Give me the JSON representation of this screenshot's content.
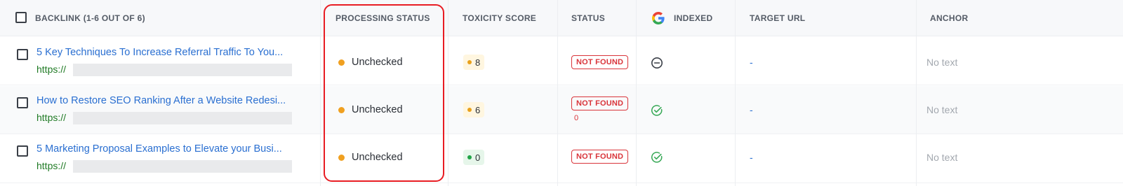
{
  "header": {
    "backlink": "BACKLINK (1-6 OUT OF 6)",
    "processing_status": "PROCESSING STATUS",
    "toxicity_score": "TOXICITY SCORE",
    "status": "STATUS",
    "indexed": "INDEXED",
    "target_url": "TARGET URL",
    "anchor": "ANCHOR"
  },
  "rows": [
    {
      "title": "5 Key Techniques To Increase Referral Traffic To You...",
      "url": "https://",
      "processing": "Unchecked",
      "toxicity": "8",
      "toxicity_level": "warning",
      "status": "NOT FOUND",
      "status_extra": "",
      "indexed_icon": "minus-circle-icon",
      "target": "-",
      "anchor": "No text"
    },
    {
      "title": "How to Restore SEO Ranking After a Website Redesi...",
      "url": "https://",
      "processing": "Unchecked",
      "toxicity": "6",
      "toxicity_level": "warning",
      "status": "NOT FOUND",
      "status_extra": "0",
      "indexed_icon": "check-circle-icon",
      "target": "-",
      "anchor": "No text"
    },
    {
      "title": "5 Marketing Proposal Examples to Elevate your Busi...",
      "url": "https://",
      "processing": "Unchecked",
      "toxicity": "0",
      "toxicity_level": "good",
      "status": "NOT FOUND",
      "status_extra": "",
      "indexed_icon": "check-circle-icon",
      "target": "-",
      "anchor": "No text"
    }
  ],
  "colors": {
    "link": "#2a6fd1",
    "url": "#1f7a24",
    "processing_dot": "#f0a020",
    "not_found": "#d9343a",
    "indexed_check": "#36a855",
    "highlight": "#e81c23"
  }
}
